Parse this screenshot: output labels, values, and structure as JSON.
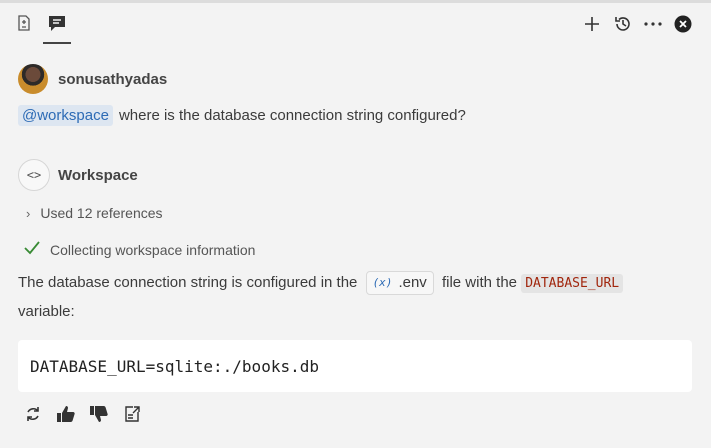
{
  "toolbar": {
    "tabs": [
      {
        "icon": "edits-icon",
        "active": false
      },
      {
        "icon": "chat-icon",
        "active": true
      }
    ],
    "actions": [
      "new-chat-icon",
      "history-icon",
      "more-icon",
      "close-icon"
    ]
  },
  "message": {
    "username": "sonusathyadas",
    "mention": "@workspace",
    "question": "where is the database connection string configured?"
  },
  "response": {
    "agent_name": "Workspace",
    "references_label": "Used 12 references",
    "progress_label": "Collecting workspace information",
    "answer_before": "The database connection string is configured in the",
    "file_var_glyph": "(x)",
    "file_name": ".env",
    "answer_mid": "file with the",
    "variable": "DATABASE_URL",
    "answer_after": "variable:",
    "code": "DATABASE_URL=sqlite:./books.db"
  },
  "colors": {
    "accent": "#2d6bb5",
    "check": "#388a34",
    "code_red": "#a1260d"
  }
}
